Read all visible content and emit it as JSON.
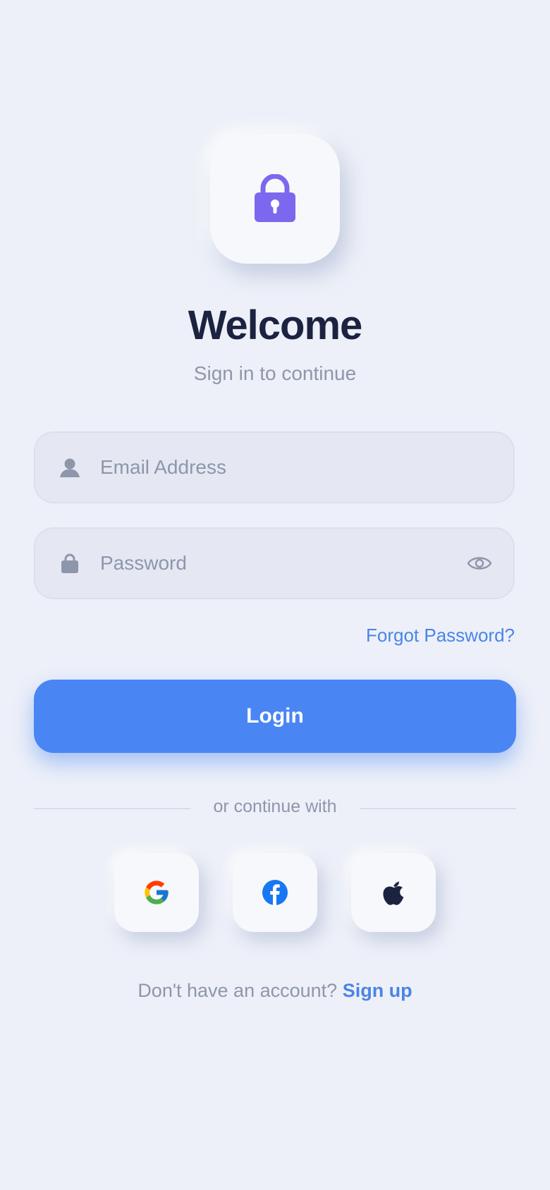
{
  "header": {
    "icon": "padlock-icon",
    "title": "Welcome",
    "subtitle": "Sign in to continue"
  },
  "form": {
    "email": {
      "icon": "user-icon",
      "placeholder": "Email Address",
      "value": ""
    },
    "password": {
      "icon": "lock-icon",
      "placeholder": "Password",
      "value": "",
      "toggle_icon": "eye-icon"
    },
    "forgot_label": "Forgot Password?",
    "login_label": "Login"
  },
  "social": {
    "divider_text": "or continue with",
    "buttons": [
      {
        "name": "google",
        "icon": "google-icon"
      },
      {
        "name": "facebook",
        "icon": "facebook-icon"
      },
      {
        "name": "apple",
        "icon": "apple-icon"
      }
    ]
  },
  "footer": {
    "prompt": "Don't have an account?",
    "signup_label": "Sign up"
  },
  "colors": {
    "background": "#EDF0F8",
    "accent": "#4A85F4",
    "lock_purple": "#7B68EE",
    "title": "#1C2340",
    "muted": "#8E96AA"
  }
}
